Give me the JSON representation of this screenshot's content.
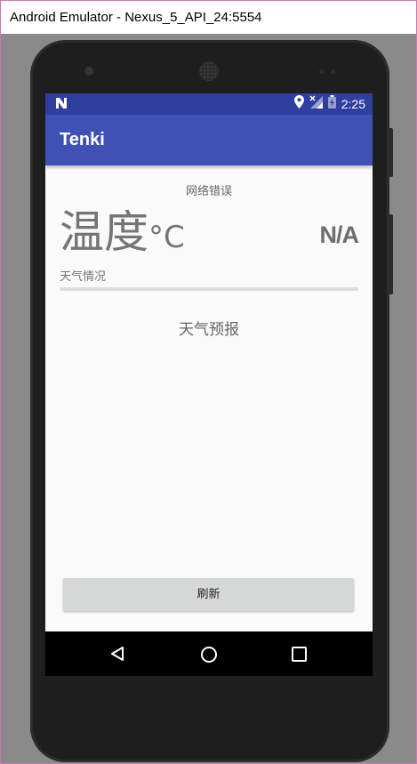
{
  "window": {
    "title": "Android Emulator - Nexus_5_API_24:5554"
  },
  "statusbar": {
    "time": "2:25"
  },
  "appbar": {
    "title": "Tenki"
  },
  "weather": {
    "error_text": "网络错误",
    "temperature": "温度",
    "unit": "°C",
    "icon_text": "N/A",
    "condition": "天气情况",
    "forecast_label": "天气预报"
  },
  "actions": {
    "refresh_label": "刷新"
  },
  "colors": {
    "primary": "#3f51b5",
    "primary_dark": "#303f9f",
    "background": "#fafafa",
    "button": "#d6d7d7"
  }
}
